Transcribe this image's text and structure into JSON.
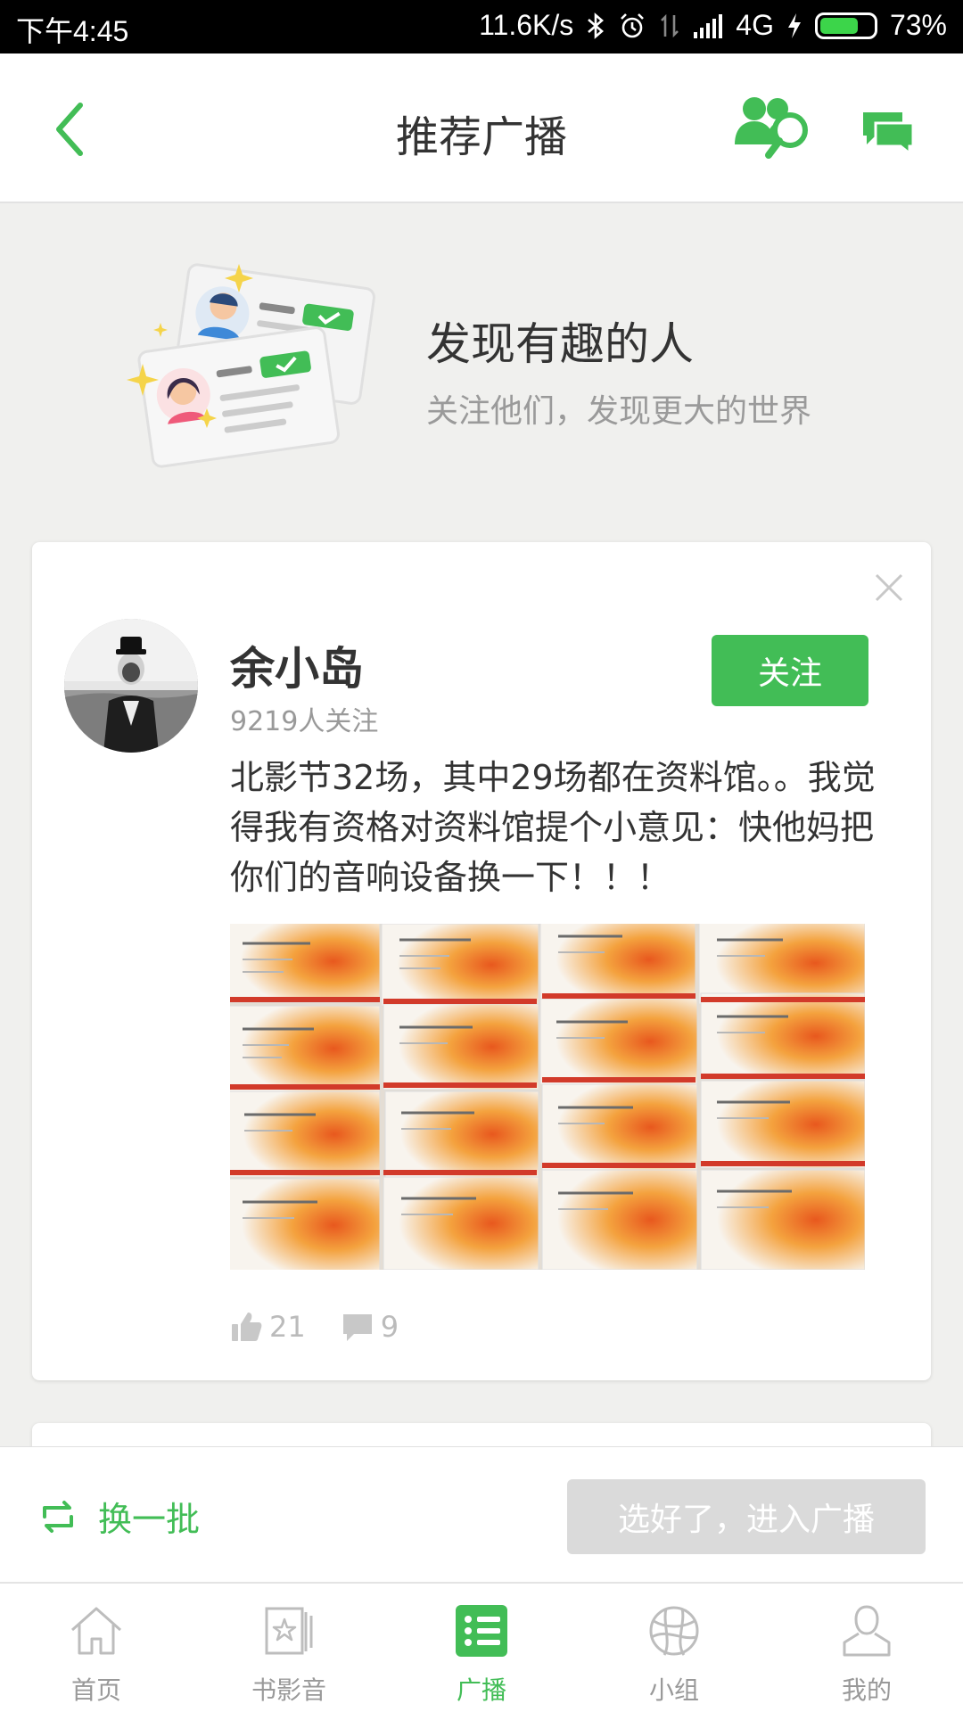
{
  "status_bar": {
    "time": "下午4:45",
    "speed": "11.6K/s",
    "network": "4G",
    "battery": "73%",
    "battery_level": 0.73
  },
  "header": {
    "title": "推荐广播"
  },
  "hero": {
    "title": "发现有趣的人",
    "subtitle": "关注他们，发现更大的世界"
  },
  "card": {
    "name": "余小岛",
    "followers": "9219人关注",
    "follow_label": "关注",
    "text": "北影节32场，其中29场都在资料馆。。我觉得我有资格对资料馆提个小意见：快他妈把你们的音响设备换一下！！！",
    "likes": "21",
    "comments": "9"
  },
  "actions": {
    "refresh_label": "换一批",
    "enter_label": "选好了，进入广播"
  },
  "tabs": [
    {
      "label": "首页",
      "icon": "home-icon"
    },
    {
      "label": "书影音",
      "icon": "media-icon"
    },
    {
      "label": "广播",
      "icon": "broadcast-icon"
    },
    {
      "label": "小组",
      "icon": "group-icon"
    },
    {
      "label": "我的",
      "icon": "profile-icon"
    }
  ],
  "colors": {
    "accent": "#42bd56",
    "disabled": "#dadada",
    "muted_text": "#999999"
  }
}
